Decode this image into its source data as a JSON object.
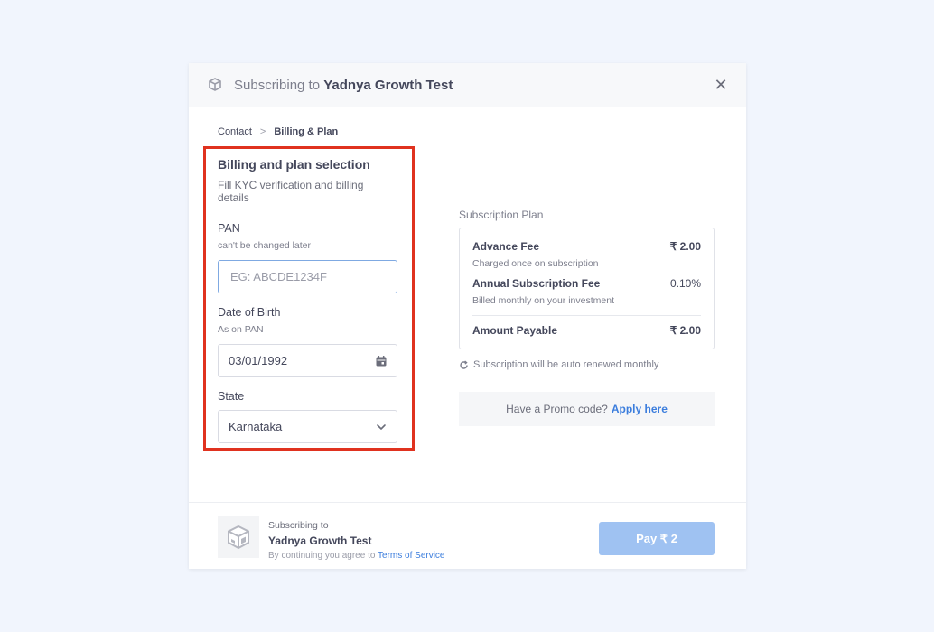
{
  "header": {
    "prefix": "Subscribing to",
    "product": "Yadnya Growth Test",
    "close_icon": "close-icon"
  },
  "breadcrumb": {
    "step1": "Contact",
    "separator": ">",
    "step2": "Billing & Plan"
  },
  "form": {
    "title": "Billing and plan selection",
    "subtitle": "Fill KYC verification and billing details",
    "pan": {
      "label": "PAN",
      "hint": "can't be changed later",
      "placeholder": "EG: ABCDE1234F",
      "value": ""
    },
    "dob": {
      "label": "Date of Birth",
      "hint": "As on PAN",
      "value": "03/01/1992",
      "icon": "calendar-icon"
    },
    "state": {
      "label": "State",
      "value": "Karnataka",
      "icon": "chevron-down-icon"
    }
  },
  "plan": {
    "title": "Subscription Plan",
    "items": [
      {
        "name": "Advance Fee",
        "desc": "Charged once on subscription",
        "value": "₹ 2.00"
      },
      {
        "name": "Annual Subscription Fee",
        "desc": "Billed monthly on your investment",
        "value": "0.10%"
      }
    ],
    "total_label": "Amount Payable",
    "total_value": "₹ 2.00"
  },
  "renew_note": "Subscription will be auto renewed monthly",
  "promo": {
    "text": "Have a Promo code?",
    "link": "Apply here"
  },
  "footer": {
    "subscribing_to": "Subscribing to",
    "product": "Yadnya Growth Test",
    "terms_prefix": "By continuing you agree to",
    "terms_link": "Terms of Service",
    "pay_label": "Pay ₹ 2"
  },
  "colors": {
    "accent": "#3b7ddd",
    "pay_button": "#9fc2f2",
    "highlight": "#e0321f"
  }
}
